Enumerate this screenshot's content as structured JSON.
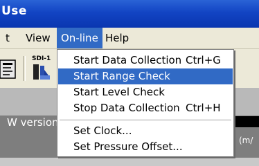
{
  "window": {
    "title": "Use"
  },
  "menubar": {
    "items": [
      {
        "label": "t"
      },
      {
        "label": "View"
      },
      {
        "label": "On-line"
      },
      {
        "label": "Help"
      }
    ]
  },
  "toolbar": {
    "sdi_label": "SDI-1"
  },
  "online_menu": {
    "items": [
      {
        "label": "Start Data Collection",
        "shortcut": "Ctrl+G"
      },
      {
        "label": "Start Range Check",
        "shortcut": ""
      },
      {
        "label": "Start Level Check",
        "shortcut": ""
      },
      {
        "label": "Stop Data Collection",
        "shortcut": "Ctrl+H"
      },
      {
        "label": "Set Clock...",
        "shortcut": ""
      },
      {
        "label": "Set Pressure Offset...",
        "shortcut": ""
      }
    ],
    "highlighted_index": 1
  },
  "background": {
    "version_text": "W version",
    "unit_text": "(m/"
  },
  "colors": {
    "titlebar": "#1244c3",
    "menubar": "#ece9d8",
    "highlight": "#316ac5"
  }
}
